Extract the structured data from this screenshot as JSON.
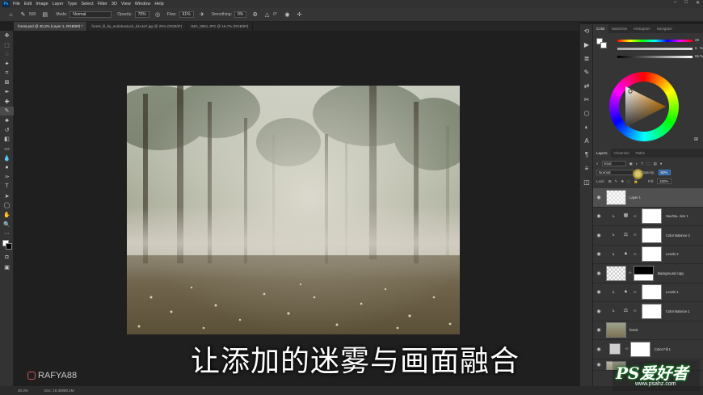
{
  "menu": {
    "app_icon": "Ps",
    "items": [
      "File",
      "Edit",
      "Image",
      "Layer",
      "Type",
      "Select",
      "Filter",
      "3D",
      "View",
      "Window",
      "Help"
    ],
    "window_controls": [
      "–",
      "□",
      "✕"
    ]
  },
  "options_bar": {
    "brush_size": "500",
    "mode_label": "Mode:",
    "mode_value": "Normal",
    "opacity_label": "Opacity:",
    "opacity_value": "70%",
    "flow_label": "Flow:",
    "flow_value": "61%",
    "smoothing_label": "Smoothing:",
    "smoothing_value": "0%",
    "angle_value": "0°"
  },
  "tabs": [
    {
      "label": "forest.psd @ 30,3% (Layer 1, RGB/8#) *",
      "active": true
    },
    {
      "label": "forest_lil_by_andokastock_d1c4a7.jpg @ 25% (RGB/8*)",
      "active": false
    },
    {
      "label": "IMG_9951.JPG @ 16,7% (RGB/8#)",
      "active": false
    }
  ],
  "tool_icons": [
    "move-icon",
    "marquee-icon",
    "lasso-icon",
    "quick-select-icon",
    "crop-icon",
    "frame-icon",
    "eyedropper-icon",
    "healing-icon",
    "brush-icon",
    "stamp-icon",
    "history-brush-icon",
    "eraser-icon",
    "gradient-icon",
    "blur-icon",
    "dodge-icon",
    "pen-icon",
    "type-icon",
    "path-select-icon",
    "shape-icon",
    "hand-icon",
    "zoom-icon",
    "more-icon",
    "colors-icon",
    "quickmask-icon",
    "screenmode-icon"
  ],
  "canvas": {
    "subtitle": "让添加的迷雾与画面融合",
    "brand": "RAFYA88"
  },
  "statusbar": {
    "zoom": "30,3%",
    "doc": "Doc: 19,3M/80,1M"
  },
  "color_panel": {
    "tabs": [
      "Color",
      "Swatches",
      "Histogram",
      "Navigator"
    ],
    "values": [
      "28",
      "6",
      "65"
    ],
    "units": [
      "",
      "%",
      "%"
    ]
  },
  "layers_panel": {
    "tabs": [
      "Layers",
      "Channels",
      "Paths"
    ],
    "filter_label": "Kind",
    "blend_mode": "Normal",
    "opacity_label": "Opacity:",
    "opacity_value": "60%",
    "lock_label": "Lock:",
    "fill_label": "Fill:",
    "fill_value": "100%",
    "layers": [
      {
        "name": "Layer 1",
        "type": "pixel",
        "selected": true
      },
      {
        "name": "Hue/Sa...tion 1",
        "type": "adjust",
        "icon": "▦"
      },
      {
        "name": "Color Balance 2",
        "type": "adjust",
        "icon": "⚖"
      },
      {
        "name": "Levels 2",
        "type": "adjust",
        "icon": "▲"
      },
      {
        "name": "Background copy",
        "type": "masked"
      },
      {
        "name": "Levels 1",
        "type": "adjust",
        "icon": "▲"
      },
      {
        "name": "Color Balance 1",
        "type": "adjust",
        "icon": "⚖"
      },
      {
        "name": "forest",
        "type": "image"
      },
      {
        "name": "Color Fill 1",
        "type": "fill"
      },
      {
        "name": "",
        "type": "image2"
      }
    ]
  },
  "watermark": {
    "big": "PS爱好者",
    "small": "www.psahz.com"
  },
  "colors": {
    "accent": "#31a8ff",
    "panel": "#353535",
    "watermark_green": "#1a7a2a"
  }
}
